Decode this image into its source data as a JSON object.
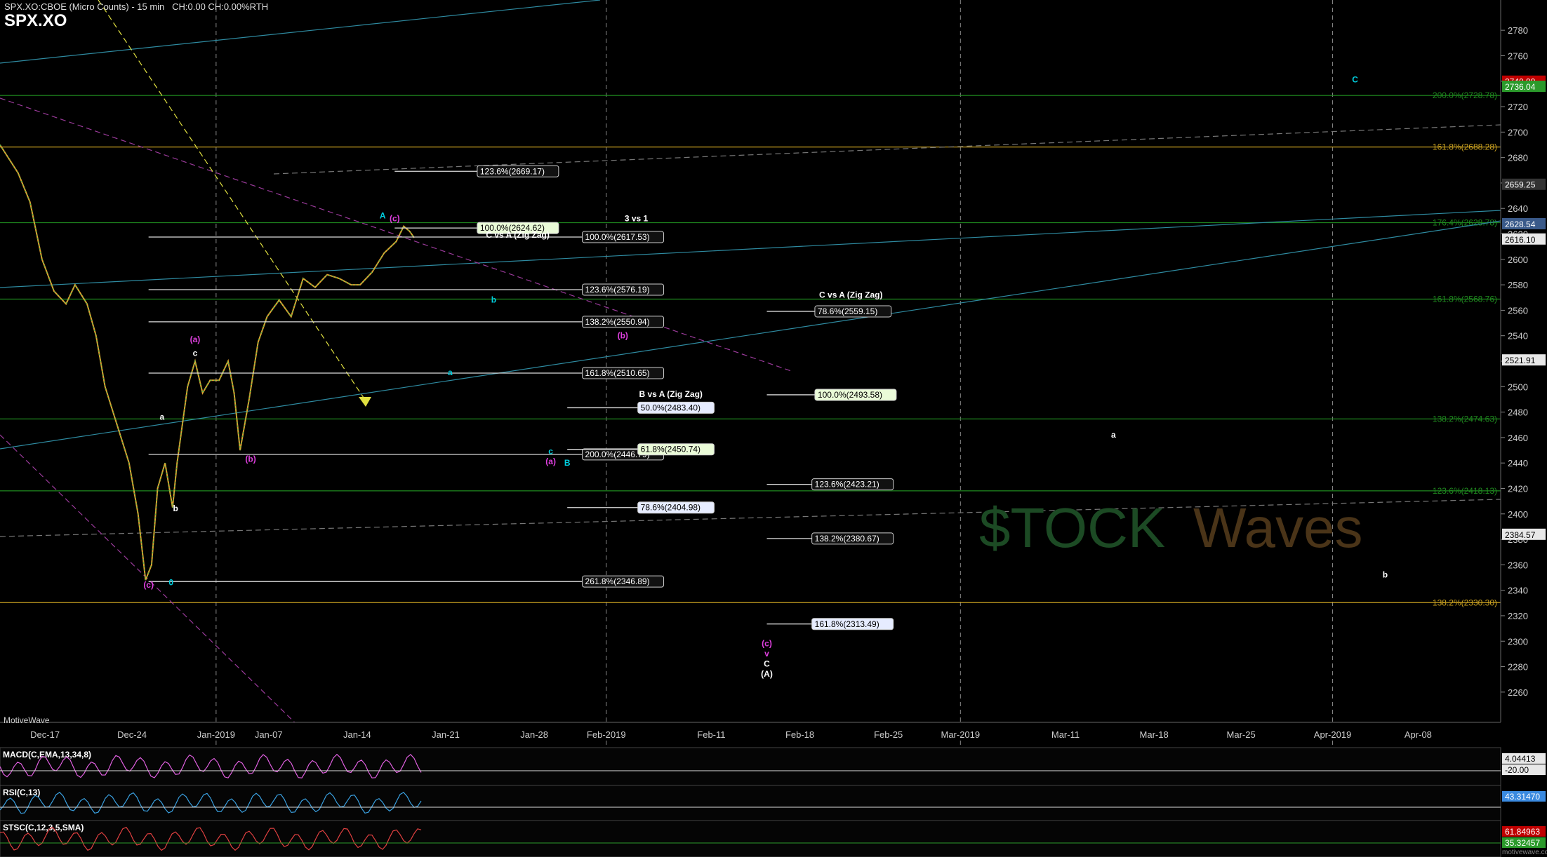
{
  "header": {
    "title": "SPX.XO:CBOE (Micro Counts) - 15 min",
    "stats": "CH:0.00 CH:0.00%RTH",
    "symbol": "SPX.XO",
    "brand": "MotiveWave",
    "watermark_a": "$TOCK",
    "watermark_b": "Waves",
    "site": "motivewave.com"
  },
  "chart_data": {
    "type": "line",
    "title": "SPX.XO:CBOE (Micro Counts) - 15 min",
    "ylim": [
      2250,
      2790
    ],
    "price_ticks": [
      2780,
      2760,
      2740,
      2720,
      2700,
      2680,
      2660,
      2640,
      2620,
      2600,
      2580,
      2560,
      2540,
      2520,
      2500,
      2480,
      2460,
      2440,
      2420,
      2400,
      2380,
      2360,
      2340,
      2320,
      2300,
      2280,
      2260
    ],
    "x_labels": [
      {
        "label": "Dec-17",
        "x": 0.03
      },
      {
        "label": "Dec-24",
        "x": 0.088
      },
      {
        "label": "Jan-2019",
        "x": 0.144
      },
      {
        "label": "Jan-07",
        "x": 0.179
      },
      {
        "label": "Jan-14",
        "x": 0.238
      },
      {
        "label": "Jan-21",
        "x": 0.297
      },
      {
        "label": "Jan-28",
        "x": 0.356
      },
      {
        "label": "Feb-2019",
        "x": 0.404
      },
      {
        "label": "Feb-11",
        "x": 0.474
      },
      {
        "label": "Feb-18",
        "x": 0.533
      },
      {
        "label": "Feb-25",
        "x": 0.592
      },
      {
        "label": "Mar-2019",
        "x": 0.64
      },
      {
        "label": "Mar-11",
        "x": 0.71
      },
      {
        "label": "Mar-18",
        "x": 0.769
      },
      {
        "label": "Mar-25",
        "x": 0.827
      },
      {
        "label": "Apr-2019",
        "x": 0.888
      },
      {
        "label": "Apr-08",
        "x": 0.945
      }
    ],
    "price_path": [
      [
        0.0,
        2690
      ],
      [
        0.012,
        2668
      ],
      [
        0.02,
        2645
      ],
      [
        0.028,
        2600
      ],
      [
        0.036,
        2575
      ],
      [
        0.044,
        2565
      ],
      [
        0.05,
        2580
      ],
      [
        0.058,
        2565
      ],
      [
        0.064,
        2540
      ],
      [
        0.07,
        2500
      ],
      [
        0.078,
        2470
      ],
      [
        0.086,
        2440
      ],
      [
        0.092,
        2400
      ],
      [
        0.097,
        2348
      ],
      [
        0.101,
        2360
      ],
      [
        0.105,
        2420
      ],
      [
        0.11,
        2440
      ],
      [
        0.115,
        2405
      ],
      [
        0.118,
        2440
      ],
      [
        0.125,
        2500
      ],
      [
        0.13,
        2520
      ],
      [
        0.135,
        2495
      ],
      [
        0.14,
        2505
      ],
      [
        0.146,
        2505
      ],
      [
        0.152,
        2520
      ],
      [
        0.156,
        2495
      ],
      [
        0.16,
        2450
      ],
      [
        0.166,
        2490
      ],
      [
        0.172,
        2535
      ],
      [
        0.178,
        2555
      ],
      [
        0.186,
        2568
      ],
      [
        0.194,
        2555
      ],
      [
        0.202,
        2585
      ],
      [
        0.21,
        2578
      ],
      [
        0.218,
        2588
      ],
      [
        0.226,
        2585
      ],
      [
        0.234,
        2580
      ],
      [
        0.24,
        2580
      ],
      [
        0.248,
        2590
      ],
      [
        0.256,
        2605
      ],
      [
        0.264,
        2614
      ],
      [
        0.269,
        2626
      ],
      [
        0.273,
        2622
      ],
      [
        0.276,
        2617
      ]
    ],
    "current_price": "2616.10",
    "right_labels": [
      {
        "price": 2740,
        "text": "2740.99",
        "bg": "#c00000"
      },
      {
        "price": 2736,
        "text": "2736.04",
        "bg": "#2b9a2b"
      },
      {
        "price": 2659,
        "text": "2659.25",
        "bg": "#333333"
      },
      {
        "price": 2628,
        "text": "2628.54",
        "bg": "#3a5a8a"
      },
      {
        "price": 2616,
        "text": "2616.10",
        "bg": "#e8e8e8"
      },
      {
        "price": 2521,
        "text": "2521.91",
        "bg": "#e8e8e8"
      },
      {
        "price": 2384,
        "text": "2384.57",
        "bg": "#e8e8e8"
      }
    ],
    "horizontal_levels": [
      {
        "price": 2728.78,
        "color": "#1f8a1f",
        "label": "200.0%(2728.78)"
      },
      {
        "price": 2688.28,
        "color": "#c9a020",
        "label": "161.8%(2688.28)"
      },
      {
        "price": 2628.78,
        "color": "#1f8a1f",
        "label": "176.4%(2628.78)"
      },
      {
        "price": 2568.76,
        "color": "#1f8a1f",
        "label": "161.8%(2568.76)"
      },
      {
        "price": 2474.63,
        "color": "#1f8a1f",
        "label": "138.2%(2474.63)"
      },
      {
        "price": 2418.13,
        "color": "#1f8a1f",
        "label": "123.6%(2418.13)"
      },
      {
        "price": 2330.3,
        "color": "#c9a020",
        "label": "138.2%(2330.30)"
      }
    ],
    "fib_boxes": [
      {
        "x1": 0.263,
        "x2": 0.318,
        "price": 2669.17,
        "text": "123.6%(2669.17)",
        "style": "dark"
      },
      {
        "x1": 0.263,
        "x2": 0.318,
        "price": 2624.62,
        "text": "100.0%(2624.62)",
        "style": "light"
      },
      {
        "x1": 0.099,
        "x2": 0.388,
        "price": 2617.53,
        "text": "100.0%(2617.53)",
        "style": "dark"
      },
      {
        "x1": 0.099,
        "x2": 0.388,
        "price": 2576.19,
        "text": "123.6%(2576.19)",
        "style": "dark"
      },
      {
        "x1": 0.099,
        "x2": 0.388,
        "price": 2550.94,
        "text": "138.2%(2550.94)",
        "style": "dark"
      },
      {
        "x1": 0.099,
        "x2": 0.388,
        "price": 2510.65,
        "text": "161.8%(2510.65)",
        "style": "dark"
      },
      {
        "x1": 0.099,
        "x2": 0.388,
        "price": 2446.79,
        "text": "200.0%(2446.79)",
        "style": "dark"
      },
      {
        "x1": 0.099,
        "x2": 0.388,
        "price": 2346.89,
        "text": "261.8%(2346.89)",
        "style": "dark"
      },
      {
        "x1": 0.378,
        "x2": 0.425,
        "price": 2483.4,
        "text": "50.0%(2483.40)",
        "style": "blue"
      },
      {
        "x1": 0.378,
        "x2": 0.425,
        "price": 2450.74,
        "text": "61.8%(2450.74)",
        "style": "light"
      },
      {
        "x1": 0.378,
        "x2": 0.425,
        "price": 2404.98,
        "text": "78.6%(2404.98)",
        "style": "blue"
      },
      {
        "x1": 0.511,
        "x2": 0.543,
        "price": 2559.15,
        "text": "78.6%(2559.15)",
        "style": "dark"
      },
      {
        "x1": 0.511,
        "x2": 0.543,
        "price": 2493.58,
        "text": "100.0%(2493.58)",
        "style": "light"
      },
      {
        "x1": 0.511,
        "x2": 0.541,
        "price": 2423.21,
        "text": "123.6%(2423.21)",
        "style": "dark"
      },
      {
        "x1": 0.511,
        "x2": 0.541,
        "price": 2380.67,
        "text": "138.2%(2380.67)",
        "style": "dark"
      },
      {
        "x1": 0.511,
        "x2": 0.541,
        "price": 2313.49,
        "text": "161.8%(2313.49)",
        "style": "blue"
      }
    ],
    "annotations": [
      {
        "text": "3 vs 1",
        "x": 0.424,
        "price": 2630,
        "color": "#ffffff"
      },
      {
        "text": "C vs A (Zig Zag)",
        "x": 0.345,
        "price": 2617,
        "color": "#ffffff"
      },
      {
        "text": "C vs A (Zig Zag)",
        "x": 0.567,
        "price": 2570,
        "color": "#ffffff"
      },
      {
        "text": "B vs A (Zig Zag)",
        "x": 0.447,
        "price": 2492,
        "color": "#ffffff"
      },
      {
        "text": "A",
        "x": 0.255,
        "price": 2632,
        "color": "#00d0e0"
      },
      {
        "text": "(c)",
        "x": 0.263,
        "price": 2630,
        "color": "#e040e0"
      },
      {
        "text": "b",
        "x": 0.329,
        "price": 2566,
        "color": "#00d0e0"
      },
      {
        "text": "(b)",
        "x": 0.415,
        "price": 2538,
        "color": "#e040e0"
      },
      {
        "text": "a",
        "x": 0.3,
        "price": 2509,
        "color": "#00d0e0"
      },
      {
        "text": "(a)",
        "x": 0.13,
        "price": 2535,
        "color": "#e040e0"
      },
      {
        "text": "c",
        "x": 0.13,
        "price": 2524,
        "color": "#ffffff"
      },
      {
        "text": "a",
        "x": 0.108,
        "price": 2474,
        "color": "#ffffff"
      },
      {
        "text": "(b)",
        "x": 0.167,
        "price": 2441,
        "color": "#e040e0"
      },
      {
        "text": "b",
        "x": 0.117,
        "price": 2402,
        "color": "#ffffff"
      },
      {
        "text": "c",
        "x": 0.367,
        "price": 2447,
        "color": "#00d0e0"
      },
      {
        "text": "(a)",
        "x": 0.367,
        "price": 2439,
        "color": "#e040e0"
      },
      {
        "text": "B",
        "x": 0.378,
        "price": 2438,
        "color": "#00d0e0"
      },
      {
        "text": "(c)",
        "x": 0.099,
        "price": 2342,
        "color": "#e040e0"
      },
      {
        "text": "0",
        "x": 0.114,
        "price": 2344,
        "color": "#00d0e0"
      },
      {
        "text": "(c)",
        "x": 0.511,
        "price": 2296,
        "color": "#e040e0"
      },
      {
        "text": "v",
        "x": 0.511,
        "price": 2288,
        "color": "#e040e0"
      },
      {
        "text": "C",
        "x": 0.511,
        "price": 2280,
        "color": "#ffffff"
      },
      {
        "text": "(A)",
        "x": 0.511,
        "price": 2272,
        "color": "#ffffff"
      },
      {
        "text": "C",
        "x": 0.903,
        "price": 2739,
        "color": "#00d0e0"
      },
      {
        "text": "a",
        "x": 0.742,
        "price": 2460,
        "color": "#ffffff"
      },
      {
        "text": "b",
        "x": 0.923,
        "price": 2350,
        "color": "#ffffff"
      }
    ],
    "indicators": [
      {
        "name": "MACD(C,EMA,13,34,8)",
        "values": [
          "4.04413",
          "-20.00"
        ],
        "colors": [
          "#e8e8e8",
          "#e8e8e8"
        ]
      },
      {
        "name": "RSI(C,13)",
        "values": [
          "43.31470"
        ],
        "colors": [
          "#3a8ae0"
        ]
      },
      {
        "name": "STSC(C,12,3,5,SMA)",
        "values": [
          "61.84963",
          "35.32457"
        ],
        "colors": [
          "#c00000",
          "#2b9a2b"
        ]
      }
    ]
  }
}
